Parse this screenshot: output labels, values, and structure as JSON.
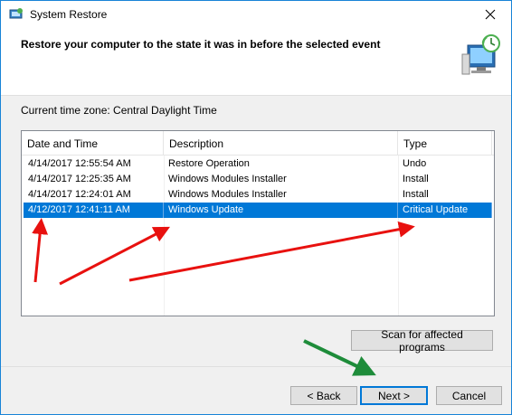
{
  "window": {
    "title": "System Restore",
    "heading": "Restore your computer to the state it was in before the selected event",
    "timezone": "Current time zone: Central Daylight Time"
  },
  "table": {
    "columns": [
      "Date and Time",
      "Description",
      "Type"
    ],
    "rows": [
      {
        "date": "4/14/2017 12:55:54 AM",
        "description": "Restore Operation",
        "type": "Undo",
        "selected": false
      },
      {
        "date": "4/14/2017 12:25:35 AM",
        "description": "Windows Modules Installer",
        "type": "Install",
        "selected": false
      },
      {
        "date": "4/14/2017 12:24:01 AM",
        "description": "Windows Modules Installer",
        "type": "Install",
        "selected": false
      },
      {
        "date": "4/12/2017 12:41:11 AM",
        "description": "Windows Update",
        "type": "Critical Update",
        "selected": true
      }
    ]
  },
  "buttons": {
    "scan": "Scan for affected programs",
    "back": "< Back",
    "next": "Next >",
    "cancel": "Cancel"
  },
  "colors": {
    "selection": "#0078d7",
    "annotation_red": "#e8110f",
    "annotation_green": "#1e8c3a"
  }
}
